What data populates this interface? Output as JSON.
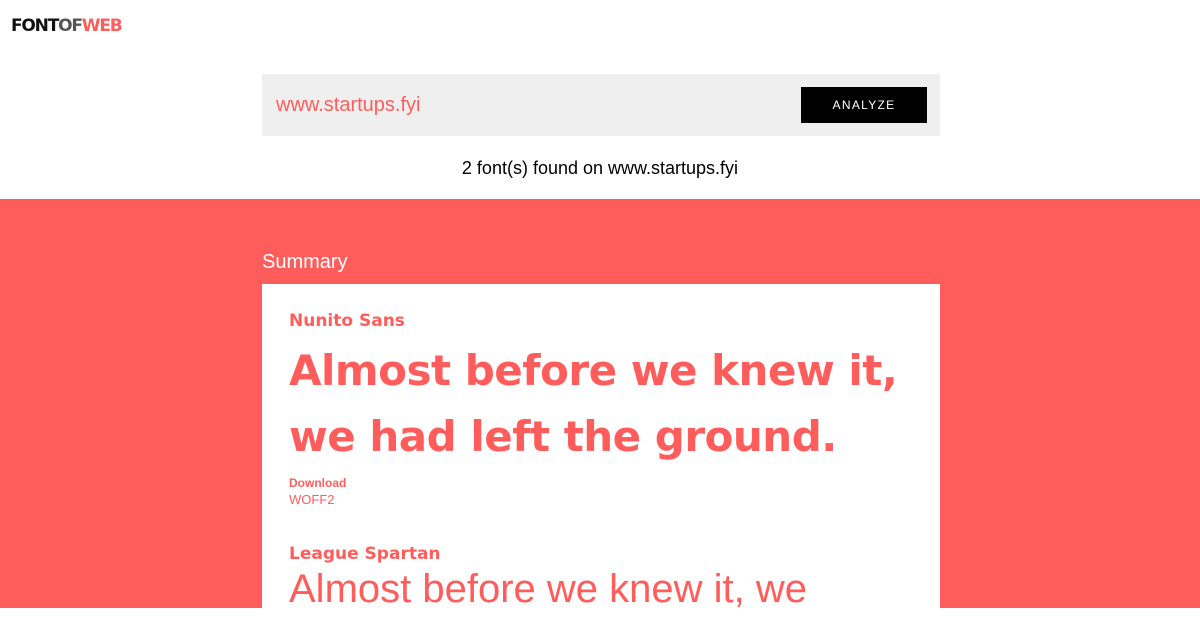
{
  "logo": {
    "part1": "FONT",
    "part2": "OF",
    "part3": "WEB"
  },
  "search": {
    "value": "www.startups.fyi",
    "button_label": "ANALYZE"
  },
  "result_count_text": "2 font(s) found on www.startups.fyi",
  "summary": {
    "heading": "Summary",
    "fonts": [
      {
        "name": "Nunito Sans",
        "sample_line1": "Almost before we knew it,",
        "sample_line2": "we had left the ground.",
        "download_label": "Download",
        "download_format": "WOFF2"
      },
      {
        "name": "League Spartan",
        "sample_visible": "Almost before we knew it, we"
      }
    ]
  },
  "colors": {
    "accent": "#ff5d5b",
    "search_background": "#efefef",
    "button_background": "#000000"
  }
}
